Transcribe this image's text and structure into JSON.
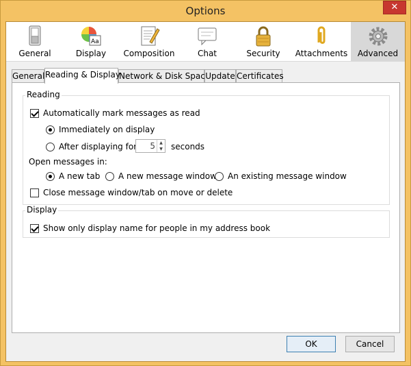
{
  "window": {
    "title": "Options",
    "close_symbol": "✕"
  },
  "toolbar": {
    "items": [
      {
        "label": "General",
        "icon": "switch-icon",
        "active": false
      },
      {
        "label": "Display",
        "icon": "color-wheel-icon",
        "active": false
      },
      {
        "label": "Composition",
        "icon": "pencil-paper-icon",
        "active": false
      },
      {
        "label": "Chat",
        "icon": "speech-bubble-icon",
        "active": false
      },
      {
        "label": "Security",
        "icon": "padlock-icon",
        "active": false
      },
      {
        "label": "Attachments",
        "icon": "paperclip-icon",
        "active": false
      },
      {
        "label": "Advanced",
        "icon": "gear-icon",
        "active": true
      }
    ]
  },
  "tabs": [
    {
      "label": "General",
      "active": false
    },
    {
      "label": "Reading & Display",
      "active": true
    },
    {
      "label": "Network & Disk Space",
      "active": false
    },
    {
      "label": "Update",
      "active": false
    },
    {
      "label": "Certificates",
      "active": false
    }
  ],
  "reading": {
    "group_title": "Reading",
    "auto_mark_label": "Automatically mark messages as read",
    "auto_mark_checked": true,
    "immediately_label": "Immediately on display",
    "immediately_selected": true,
    "after_label": "After displaying for",
    "after_selected": false,
    "after_value": "5",
    "seconds_label": "seconds",
    "open_messages_label": "Open messages in:",
    "open_new_tab_label": "A new tab",
    "open_new_tab_selected": true,
    "open_new_window_label": "A new message window",
    "open_new_window_selected": false,
    "open_existing_label": "An existing message window",
    "open_existing_selected": false,
    "close_window_label": "Close message window/tab on move or delete",
    "close_window_checked": false
  },
  "display": {
    "group_title": "Display",
    "show_display_name_label": "Show only display name for people in my address book",
    "show_display_name_checked": true
  },
  "buttons": {
    "ok": "OK",
    "cancel": "Cancel"
  },
  "colors": {
    "title_bar": "#f4c264",
    "close": "#c7372f"
  }
}
